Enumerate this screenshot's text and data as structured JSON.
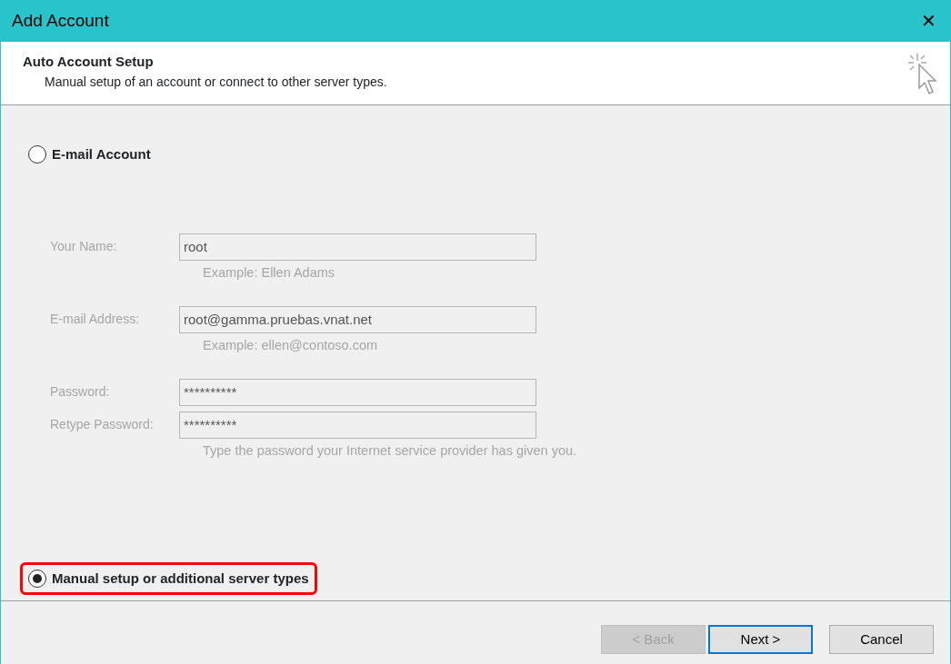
{
  "window": {
    "title": "Add Account",
    "close_glyph": "✕"
  },
  "header": {
    "title": "Auto Account Setup",
    "subtitle": "Manual setup of an account or connect to other server types."
  },
  "options": [
    {
      "label": "E-mail Account",
      "selected": false,
      "highlighted": false,
      "fields": [
        {
          "label": "Your Name:",
          "value": "root",
          "hint": "Example: Ellen Adams",
          "disabled": true
        },
        {
          "label": "E-mail Address:",
          "value": "root@gamma.pruebas.vnat.net",
          "hint": "Example: ellen@contoso.com",
          "disabled": true
        },
        {
          "label": "Password:",
          "value": "**********",
          "disabled": true
        },
        {
          "label": "Retype Password:",
          "value": "**********",
          "hint": "Type the password your Internet service provider has given you.",
          "disabled": true
        }
      ]
    },
    {
      "label": "Manual setup or additional server types",
      "selected": true,
      "highlighted": true
    }
  ],
  "buttons": [
    {
      "label": "< Back",
      "disabled": true,
      "default": false
    },
    {
      "label": "Next >",
      "disabled": false,
      "default": true
    },
    {
      "label": "Cancel",
      "disabled": false,
      "default": false
    }
  ]
}
